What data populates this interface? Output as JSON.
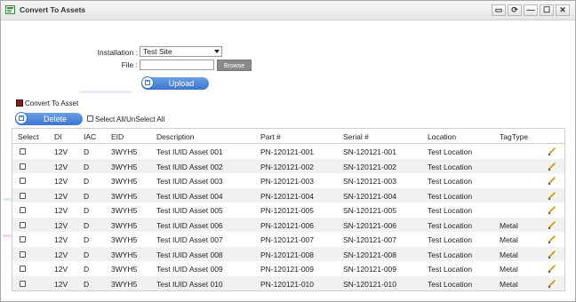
{
  "window": {
    "title": "Convert To Assets",
    "controls": [
      {
        "name": "save-layout-icon",
        "glyph": "▭"
      },
      {
        "name": "refresh-icon",
        "glyph": "⟳"
      },
      {
        "name": "minimize-icon",
        "glyph": "—"
      },
      {
        "name": "maximize-icon",
        "glyph": "☐"
      },
      {
        "name": "close-icon",
        "glyph": "✕"
      }
    ]
  },
  "form": {
    "installation_label": "Installation :",
    "installation_value": "Test Site",
    "file_label": "File :",
    "file_value": "",
    "browse_label": "Browse",
    "upload_label": "Upload"
  },
  "options": {
    "convert_label": "Convert To Asset",
    "delete_label": "Delete",
    "select_all_label": "Select All/UnSelect All"
  },
  "table": {
    "columns": [
      "Select",
      "DI",
      "IAC",
      "EID",
      "Description",
      "Part #",
      "Serial #",
      "Location",
      "TagType"
    ],
    "rows": [
      {
        "di": "12V",
        "iac": "D",
        "eid": "3WYH5",
        "desc": "Test IUID Asset 001",
        "part": "PN-120121-001",
        "serial": "SN-120121-001",
        "location": "Test Location",
        "tag": ""
      },
      {
        "di": "12V",
        "iac": "D",
        "eid": "3WYH5",
        "desc": "Test IUID Asset 002",
        "part": "PN-120121-002",
        "serial": "SN-120121-002",
        "location": "Test Location",
        "tag": ""
      },
      {
        "di": "12V",
        "iac": "D",
        "eid": "3WYH5",
        "desc": "Test IUID Asset 003",
        "part": "PN-120121-003",
        "serial": "SN-120121-003",
        "location": "Test Location",
        "tag": ""
      },
      {
        "di": "12V",
        "iac": "D",
        "eid": "3WYH5",
        "desc": "Test IUID Asset 004",
        "part": "PN-120121-004",
        "serial": "SN-120121-004",
        "location": "Test Location",
        "tag": ""
      },
      {
        "di": "12V",
        "iac": "D",
        "eid": "3WYH5",
        "desc": "Test IUID Asset 005",
        "part": "PN-120121-005",
        "serial": "SN-120121-005",
        "location": "Test Location",
        "tag": ""
      },
      {
        "di": "12V",
        "iac": "D",
        "eid": "3WYH5",
        "desc": "Test IUID Asset 006",
        "part": "PN-120121-006",
        "serial": "SN-120121-006",
        "location": "Test Location",
        "tag": "Metal"
      },
      {
        "di": "12V",
        "iac": "D",
        "eid": "3WYH5",
        "desc": "Test IUID Asset 007",
        "part": "PN-120121-007",
        "serial": "SN-120121-007",
        "location": "Test Location",
        "tag": "Metal"
      },
      {
        "di": "12V",
        "iac": "D",
        "eid": "3WYH5",
        "desc": "Test IUID Asset 008",
        "part": "PN-120121-008",
        "serial": "SN-120121-008",
        "location": "Test Location",
        "tag": "Metal"
      },
      {
        "di": "12V",
        "iac": "D",
        "eid": "3WYH5",
        "desc": "Test IUID Asset 009",
        "part": "PN-120121-009",
        "serial": "SN-120121-009",
        "location": "Test Location",
        "tag": "Metal"
      },
      {
        "di": "12V",
        "iac": "D",
        "eid": "3WYH5",
        "desc": "Test IUID Asset 010",
        "part": "PN-120121-010",
        "serial": "SN-120121-010",
        "location": "Test Location",
        "tag": "Metal"
      }
    ]
  },
  "colors": {
    "button_blue": "#3a75cf",
    "edit_icon": "#d8a020",
    "row_alt": "#f1f1f1"
  }
}
